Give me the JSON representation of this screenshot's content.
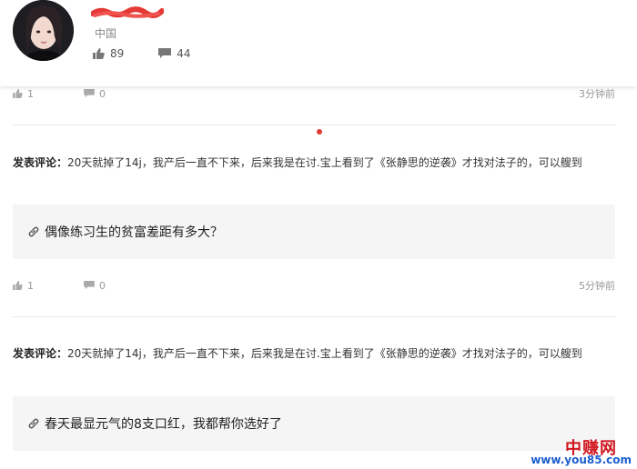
{
  "profile": {
    "location": "中国",
    "likes": "89",
    "comments": "44",
    "username_redaction_color": "#e53935"
  },
  "feed": [
    {
      "likes": "1",
      "replies": "0",
      "time": "3分钟前"
    },
    {
      "comment_label": "发表评论：",
      "comment_text": "20天就掉了14j，我产后一直不下来，后来我是在讨.宝上看到了《张静思的逆袭》才找对法子的，可以艘到",
      "link_title": "偶像练习生的贫富差距有多大？",
      "likes": "1",
      "replies": "0",
      "time": "5分钟前"
    },
    {
      "comment_label": "发表评论：",
      "comment_text": "20天就掉了14j，我产后一直不下来，后来我是在讨.宝上看到了《张静思的逆袭》才找对法子的，可以艘到",
      "link_title": "春天最显元气的8支口红，我都帮你选好了"
    }
  ],
  "watermark": {
    "line1": "中赚网",
    "line2": "www.you85.com"
  },
  "colors": {
    "accent_red": "#e53935",
    "card_bg": "#f5f5f5",
    "watermark_red": "#d2161f",
    "watermark_blue": "#1b5fcf"
  }
}
